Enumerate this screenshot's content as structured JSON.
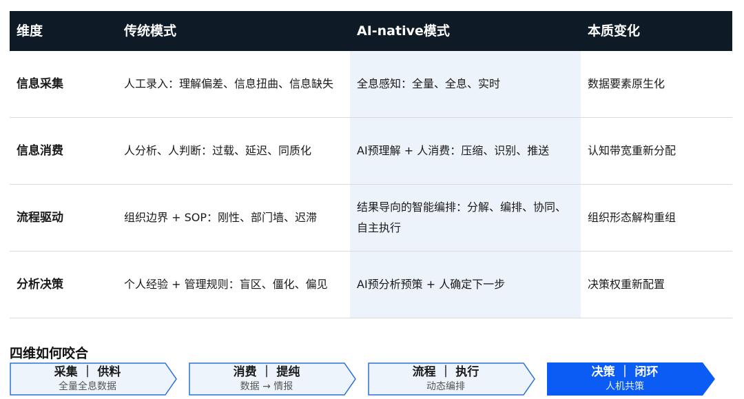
{
  "table": {
    "headers": [
      "维度",
      "传统模式",
      "AI-native模式",
      "本质变化"
    ],
    "rows": [
      [
        "信息采集",
        "人工录入：理解偏差、信息扭曲、信息缺失",
        "全息感知：全量、全息、实时",
        "数据要素原生化"
      ],
      [
        "信息消费",
        "人分析、人判断：过载、延迟、同质化",
        "AI预理解 + 人消费：压缩、识别、推送",
        "认知带宽重新分配"
      ],
      [
        "流程驱动",
        "组织边界 + SOP：刚性、部门墙、迟滞",
        "结果导向的智能编排：分解、编排、协同、自主执行",
        "组织形态解构重组"
      ],
      [
        "分析决策",
        "个人经验 + 管理规则：盲区、僵化、偏见",
        "AI预分析预策 + 人确定下一步",
        "决策权重新配置"
      ]
    ]
  },
  "section_title": "四维如何咬合",
  "flow": {
    "steps": [
      {
        "title": "采集 ｜ 供料",
        "subtitle": "全量全息数据"
      },
      {
        "title": "消费 ｜ 提纯",
        "subtitle": "数据 → 情报"
      },
      {
        "title": "流程 ｜ 执行",
        "subtitle": "动态编排"
      },
      {
        "title": "决策 ｜ 闭环",
        "subtitle": "人机共策"
      }
    ],
    "colors": {
      "default_fill": "#eef4fc",
      "default_stroke": "#2b6fd6",
      "active_fill": "#0a5cf5"
    }
  },
  "colors": {
    "header_bg": "#0e1a26",
    "highlight_col": "#edf3fb"
  }
}
